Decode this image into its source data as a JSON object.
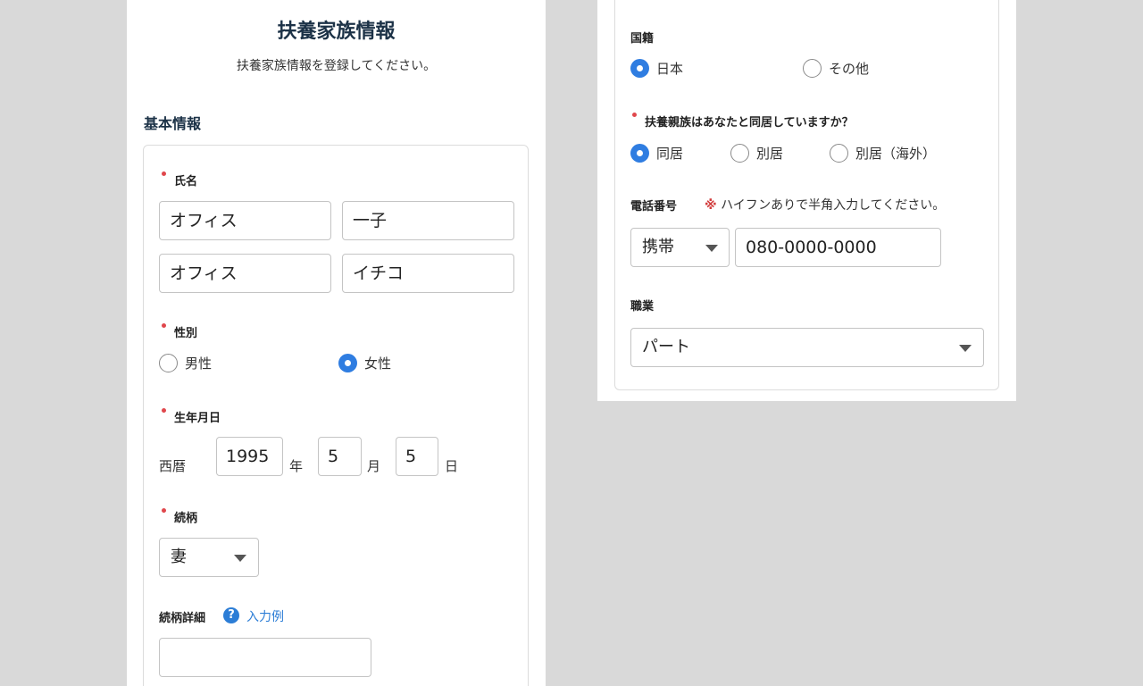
{
  "header": {
    "title": "扶養家族情報",
    "subtitle": "扶養家族情報を登録してください。"
  },
  "basic_info": {
    "section_title": "基本情報",
    "name": {
      "label": "氏名",
      "last_name": "オフィス",
      "first_name": "一子",
      "last_name_kana": "オフィス",
      "first_name_kana": "イチコ"
    },
    "gender": {
      "label": "性別",
      "options": [
        "男性",
        "女性"
      ],
      "selected": "女性"
    },
    "birthdate": {
      "label": "生年月日",
      "era": "西暦",
      "year": "1995",
      "year_unit": "年",
      "month": "5",
      "month_unit": "月",
      "day": "5",
      "day_unit": "日"
    },
    "relationship": {
      "label": "続柄",
      "value": "妻"
    },
    "relationship_detail": {
      "label": "続柄詳細",
      "help_link": "入力例",
      "value": ""
    }
  },
  "right_form": {
    "nationality": {
      "label": "国籍",
      "options": [
        "日本",
        "その他"
      ],
      "selected": "日本"
    },
    "cohabitation": {
      "label": "扶養親族はあなたと同居していますか？",
      "options": [
        "同居",
        "別居",
        "別居（海外）"
      ],
      "selected": "同居"
    },
    "phone": {
      "label": "電話番号",
      "hint_mark": "※",
      "hint": "ハイフンありで半角入力してください。",
      "type": "携帯",
      "number": "080-0000-0000"
    },
    "occupation": {
      "label": "職業",
      "value": "パート"
    }
  },
  "colors": {
    "accent": "#2f7de1",
    "required": "#e0474c",
    "title": "#1c3247",
    "link": "#2c7dd6"
  }
}
